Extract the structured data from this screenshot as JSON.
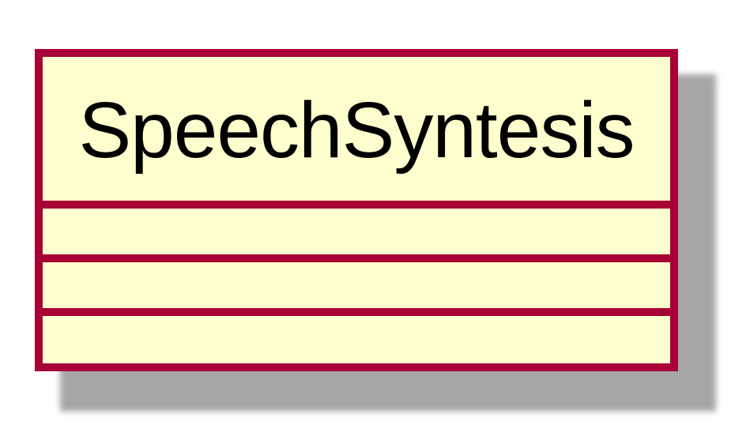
{
  "diagram": {
    "type": "uml-class",
    "class": {
      "name": "SpeechSyntesis",
      "fields": [],
      "methods": [],
      "extra": []
    },
    "colors": {
      "border": "#a80036",
      "fill": "#fefece",
      "shadow": "#a6a6a6",
      "text": "#000000"
    }
  }
}
